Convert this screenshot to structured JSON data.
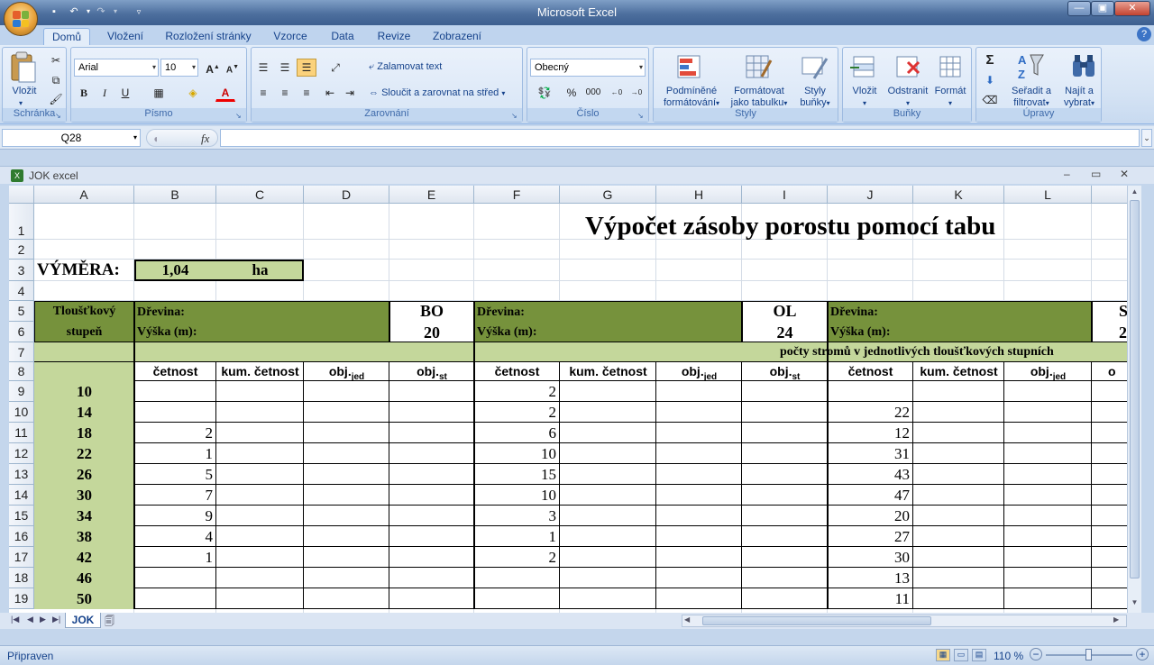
{
  "app": {
    "title": "Microsoft Excel"
  },
  "tabs": [
    "Domů",
    "Vložení",
    "Rozložení stránky",
    "Vzorce",
    "Data",
    "Revize",
    "Zobrazení"
  ],
  "ribbon": {
    "clipboard": {
      "paste": "Vložit",
      "label": "Schránka"
    },
    "font": {
      "name": "Arial",
      "size": "10",
      "bold": "B",
      "italic": "I",
      "underline": "U",
      "label": "Písmo"
    },
    "alignment": {
      "wrap": "Zalamovat text",
      "merge": "Sloučit a zarovnat na střed",
      "label": "Zarovnání"
    },
    "number": {
      "format": "Obecný",
      "percent": "%",
      "thousands": "000",
      "label": "Číslo"
    },
    "styles": {
      "cond_1": "Podmíněné",
      "cond_2": "formátování",
      "table_1": "Formátovat",
      "table_2": "jako tabulku",
      "cell_1": "Styly",
      "cell_2": "buňky",
      "label": "Styly"
    },
    "cells": {
      "insert": "Vložit",
      "delete": "Odstranit",
      "format": "Formát",
      "label": "Buňky"
    },
    "editing": {
      "sum": "Σ",
      "sort_1": "Seřadit a",
      "sort_2": "filtrovat",
      "find_1": "Najít a",
      "find_2": "vybrat",
      "label": "Úpravy"
    }
  },
  "formula_bar": {
    "name_box": "Q28",
    "fx": "fx",
    "formula": ""
  },
  "workbook": {
    "title": "JOK excel",
    "sheet_tab": "JOK"
  },
  "columns": [
    "A",
    "B",
    "C",
    "D",
    "E",
    "F",
    "G",
    "H",
    "I",
    "J",
    "K",
    "L",
    ""
  ],
  "rows": [
    "1",
    "2",
    "3",
    "4",
    "5",
    "6",
    "7",
    "8",
    "9",
    "10",
    "11",
    "12",
    "13",
    "14",
    "15",
    "16",
    "17",
    "18",
    "19"
  ],
  "sheet": {
    "title": "Výpočet zásoby porostu pomocí tabu",
    "vymera_label": "VÝMĚRA:",
    "vymera_value": "1,04",
    "vymera_unit": "ha",
    "stupen_1": "Tloušťkový",
    "stupen_2": "stupeň",
    "drevina_label": "Dřevina:",
    "vyska_label": "Výška (m):",
    "species": [
      {
        "code": "BO",
        "height": "20"
      },
      {
        "code": "OL",
        "height": "24"
      },
      {
        "code": "S",
        "height": "2"
      }
    ],
    "counts_note": "počty stromů v jednotlivých tloušťkových stupních",
    "headers": {
      "cetnost": "četnost",
      "kum": "kum. četnost",
      "obj": "obj.",
      "jed": "jed",
      "st": "st",
      "partial": "o"
    },
    "stupne": [
      "10",
      "14",
      "18",
      "22",
      "26",
      "30",
      "34",
      "38",
      "42",
      "46",
      "50"
    ],
    "bo_cetnost": [
      "",
      "",
      "2",
      "1",
      "5",
      "7",
      "9",
      "4",
      "1",
      "",
      ""
    ],
    "ol_cetnost": [
      "2",
      "2",
      "6",
      "10",
      "15",
      "10",
      "3",
      "1",
      "2",
      "",
      ""
    ],
    "s_cetnost": [
      "",
      "22",
      "12",
      "31",
      "43",
      "47",
      "20",
      "27",
      "30",
      "13",
      "11"
    ]
  },
  "status": {
    "ready": "Připraven",
    "zoom": "110 %"
  }
}
